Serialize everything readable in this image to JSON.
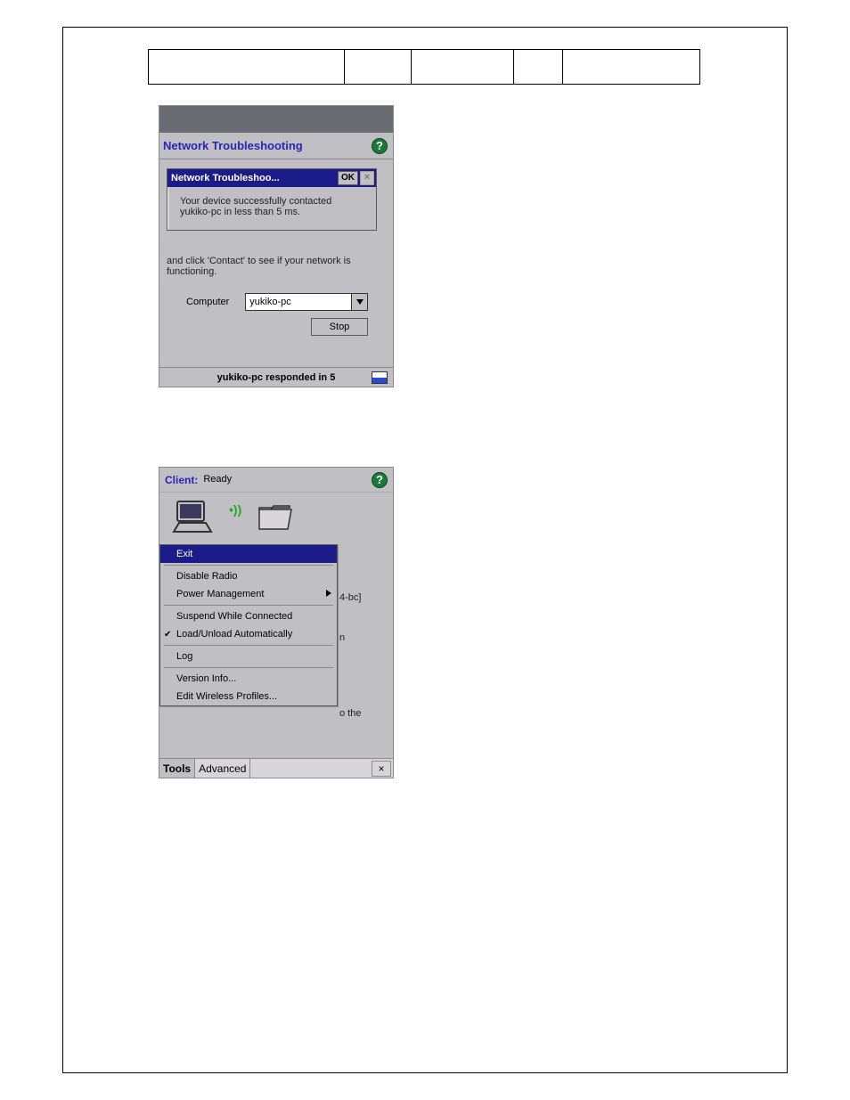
{
  "header": {
    "cells": [
      "",
      "",
      "",
      "",
      ""
    ]
  },
  "shot1": {
    "title": "Network Troubleshooting",
    "dialog": {
      "title": "Network Troubleshoo...",
      "ok": "OK",
      "body": "Your device successfully contacted yukiko-pc in less than 5 ms."
    },
    "instruction": "and click 'Contact' to see if your network is functioning.",
    "field_label": "Computer",
    "combo_value": "yukiko-pc",
    "stop_label": "Stop",
    "status": "yukiko-pc responded in 5"
  },
  "shot2": {
    "client_label": "Client:",
    "ready_label": "Ready",
    "menu": {
      "exit": "Exit",
      "disable_radio": "Disable Radio",
      "power_mgmt": "Power Management",
      "suspend": "Suspend While Connected",
      "loadunload": "Load/Unload Automatically",
      "log": "Log",
      "version": "Version Info...",
      "edit_profiles": "Edit Wireless Profiles..."
    },
    "behind": {
      "bc": "4-bc]",
      "n": "n",
      "othe": "o the"
    },
    "menubar": {
      "tools": "Tools",
      "advanced": "Advanced"
    }
  }
}
